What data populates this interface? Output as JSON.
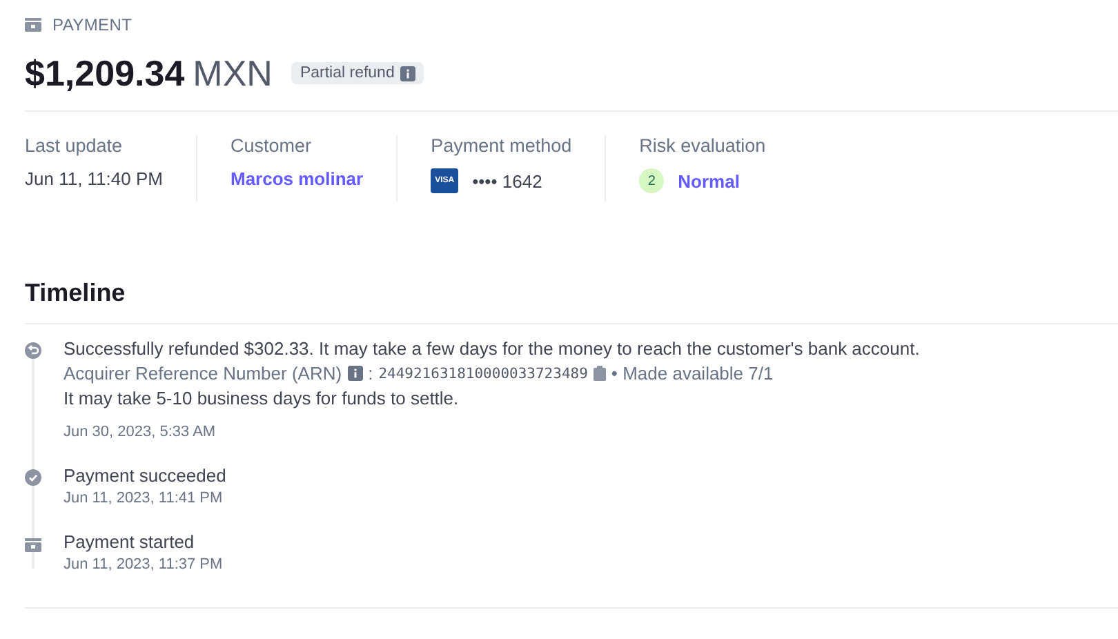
{
  "header": {
    "label": "PAYMENT",
    "amount": "$1,209.34",
    "currency": "MXN",
    "badge": "Partial refund"
  },
  "summary": [
    {
      "kind": "text",
      "label": "Last update",
      "value": "Jun 11, 11:40 PM"
    },
    {
      "kind": "link",
      "label": "Customer",
      "value": "Marcos molinar"
    },
    {
      "kind": "card",
      "label": "Payment method",
      "brand": "VISA",
      "value": "•••• 1642"
    },
    {
      "kind": "risk",
      "label": "Risk evaluation",
      "score": "2",
      "value": "Normal"
    }
  ],
  "timeline": {
    "title": "Timeline",
    "events": [
      {
        "kind": "refund",
        "text": "Successfully refunded $302.33. It may take a few days for the money to reach the customer's bank account.",
        "arn_label": "Acquirer Reference Number (ARN)",
        "separator": ":",
        "arn": "244921631810000033723489",
        "availability": "• Made available 7/1",
        "note": "It may take 5-10 business days for funds to settle.",
        "time": "Jun 30, 2023, 5:33 AM"
      },
      {
        "kind": "succeeded",
        "text": "Payment succeeded",
        "time": "Jun 11, 2023, 11:41 PM"
      },
      {
        "kind": "started",
        "text": "Payment started",
        "time": "Jun 11, 2023, 11:37 PM"
      }
    ]
  }
}
